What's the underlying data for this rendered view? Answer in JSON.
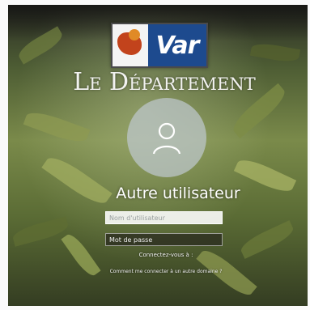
{
  "brand": {
    "logo_text": "Var",
    "department_title": "Le Département"
  },
  "login": {
    "user_display_name": "Autre utilisateur",
    "username_placeholder": "Nom d'utilisateur",
    "password_placeholder": "Mot de passe",
    "connect_to_text": "Connectez-vous à :",
    "other_domain_link": "Comment me connecter à un autre domaine ?"
  },
  "icons": {
    "avatar": "user-icon"
  },
  "colors": {
    "logo_blue": "#1d4a8e",
    "logo_red": "#c2431c",
    "logo_orange": "#e08a26"
  }
}
